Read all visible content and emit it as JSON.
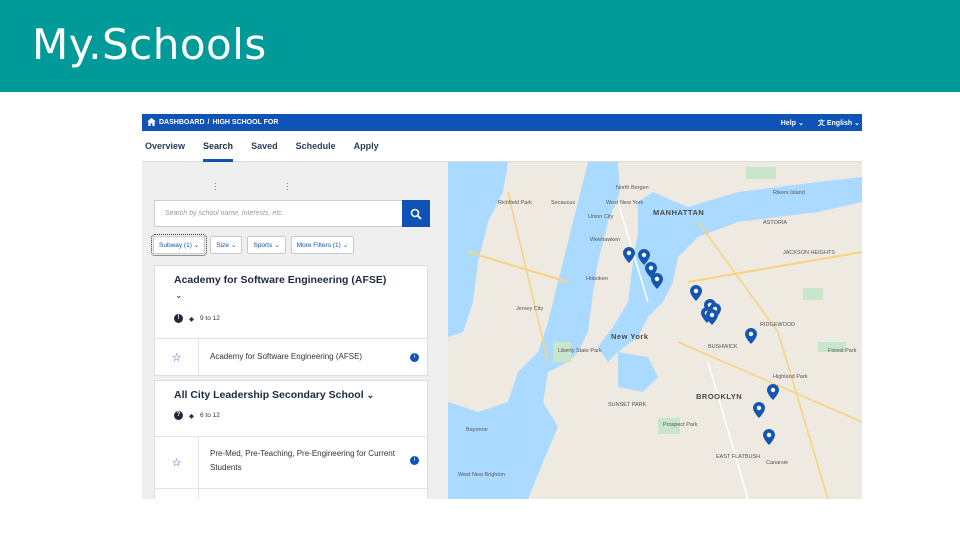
{
  "slide": {
    "title": "My.Schools"
  },
  "topbar": {
    "breadcrumb_home": "DASHBOARD",
    "breadcrumb_sep": "/",
    "breadcrumb_current": "HIGH SCHOOL FOR",
    "help_label": "Help",
    "language_label": "English"
  },
  "tabs": [
    {
      "label": "Overview"
    },
    {
      "label": "Search"
    },
    {
      "label": "Saved"
    },
    {
      "label": "Schedule"
    },
    {
      "label": "Apply"
    }
  ],
  "search": {
    "placeholder": "Search by school name, interests, etc."
  },
  "filters": [
    {
      "label": "Subway (1)"
    },
    {
      "label": "Size"
    },
    {
      "label": "Sports"
    },
    {
      "label": "More Filters (1)"
    }
  ],
  "results": [
    {
      "name": "Academy for Software Engineering (AFSE)",
      "grades": "9 to 12",
      "programs": [
        "Academy for Software Engineering (AFSE)"
      ]
    },
    {
      "name": "All City Leadership Secondary School",
      "grades": "6 to 12",
      "programs": [
        "Pre-Med, Pre-Teaching, Pre-Engineering for Current Students"
      ]
    }
  ],
  "map": {
    "labels": {
      "manhattan": "MANHATTAN",
      "brooklyn": "BROOKLYN",
      "new_york": "New York",
      "jersey_city": "Jersey City",
      "union_city": "Union City",
      "hoboken": "Hoboken",
      "north_bergen": "North Bergen",
      "secaucus": "Secaucus",
      "west_new_york": "West New York",
      "weehawken": "Weehawken",
      "rikers": "Rikers Island",
      "prospect_park": "Prospect Park",
      "forest_park": "Forest Park",
      "highland_park": "Highland Park",
      "liberty_park": "Liberty State Park",
      "bayonne": "Bayonne",
      "west_new_brighton": "West New Brighton",
      "richfield": "Richfield Park",
      "canarsie": "Canarsie",
      "bushwick": "BUSHWICK",
      "east_flatbush": "EAST FLATBUSH",
      "astoria": "ASTORIA",
      "jackson_heights": "JACKSON HEIGHTS",
      "ridgewood": "RIDGEWOOD",
      "sunset_park": "SUNSET PARK"
    },
    "pin_color": "#1557b0"
  },
  "colors": {
    "header_teal": "#009a98",
    "brand_blue": "#0e53b5"
  }
}
